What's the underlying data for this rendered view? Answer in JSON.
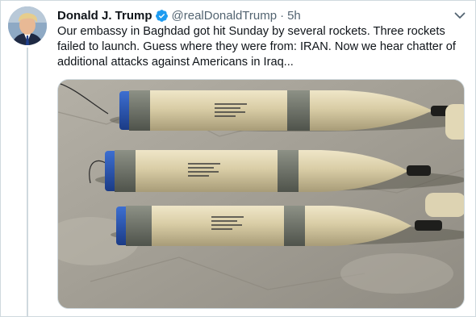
{
  "tweet": {
    "author_name": "Donald J. Trump",
    "handle": "@realDonaldTrump",
    "separator": "·",
    "time": "5h",
    "text": "Our embassy in Baghdad got hit Sunday by several rockets. Three rockets failed to launch. Guess where they were from: IRAN. Now we hear chatter of additional attacks against Americans in Iraq...",
    "verified": true
  },
  "icons": {
    "verified": "verified-badge-icon",
    "more": "chevron-down-icon"
  },
  "media": {
    "subject": "rockets-photo",
    "rocket_count": 3
  },
  "colors": {
    "verified_blue": "#1d9bf0",
    "secondary_text": "#536471",
    "border": "#cfd9de"
  }
}
